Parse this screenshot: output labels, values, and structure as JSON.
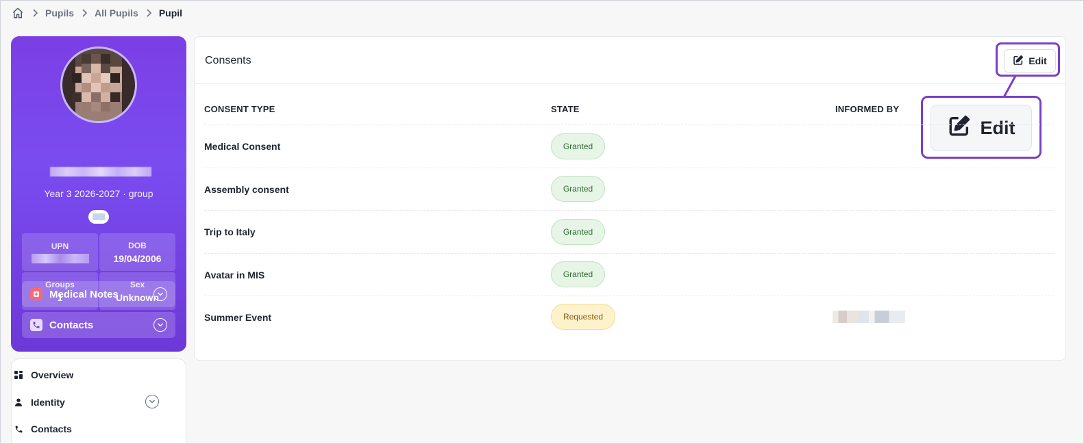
{
  "breadcrumb": {
    "items": [
      "Pupils",
      "All Pupils"
    ],
    "current": "Pupil"
  },
  "profile": {
    "year_group": "Year 3 2026-2027 · group",
    "stats": {
      "upn_label": "UPN",
      "dob_label": "DOB",
      "dob_value": "19/04/2006",
      "groups_label": "Groups",
      "groups_value": "1",
      "sex_label": "Sex",
      "sex_value": "Unknown"
    },
    "accordions": {
      "medical_notes": "Medical Notes",
      "contacts": "Contacts"
    }
  },
  "nav": {
    "overview": "Overview",
    "identity": "Identity",
    "contacts": "Contacts"
  },
  "consents": {
    "title": "Consents",
    "edit_label": "Edit",
    "headers": {
      "type": "CONSENT TYPE",
      "state": "STATE",
      "informed_by": "INFORMED BY"
    },
    "rows": [
      {
        "type": "Medical Consent",
        "state": "Granted"
      },
      {
        "type": "Assembly consent",
        "state": "Granted"
      },
      {
        "type": "Trip to Italy",
        "state": "Granted"
      },
      {
        "type": "Avatar in MIS",
        "state": "Granted"
      },
      {
        "type": "Summer Event",
        "state": "Requested"
      }
    ]
  },
  "colors": {
    "accent": "#7a3fc8",
    "profile_gradient_top": "#7b3fe4",
    "granted_bg": "#e6f5e6",
    "requested_bg": "#fdf2cc"
  },
  "icons": {
    "home": "home-icon",
    "separator": "chevron-right-icon",
    "edit": "edit-icon",
    "medical": "medical-notes-icon",
    "phone": "phone-icon",
    "overview": "grid-icon",
    "identity": "user-icon"
  }
}
